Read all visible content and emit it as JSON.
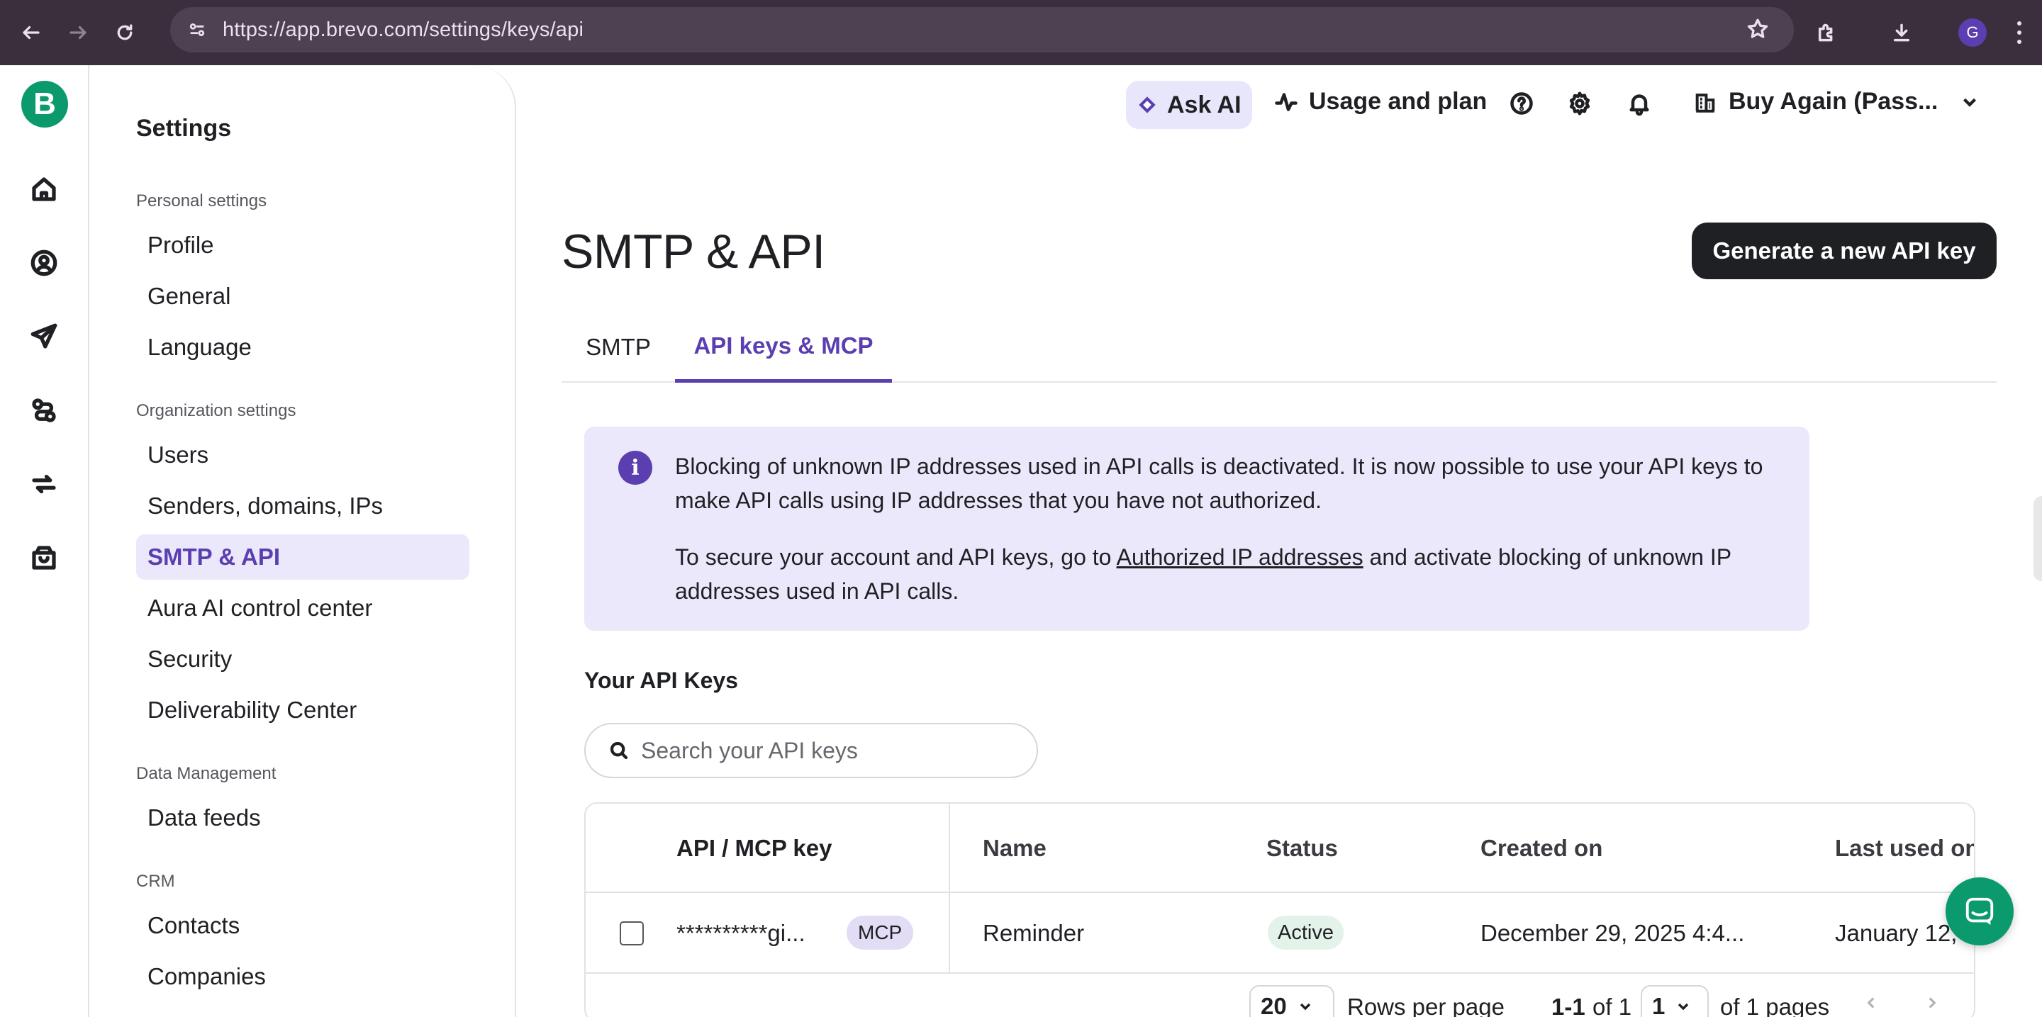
{
  "browser": {
    "url": "https://app.brevo.com/settings/keys/api",
    "profile_initial": "G"
  },
  "rail": {
    "logo_letter": "B",
    "icons": [
      "home-icon",
      "contacts-icon",
      "campaigns-icon",
      "automations-icon",
      "conversations-icon",
      "commerce-icon"
    ]
  },
  "sidebar": {
    "title": "Settings",
    "sections": [
      {
        "label": "Personal settings",
        "items": [
          "Profile",
          "General",
          "Language"
        ]
      },
      {
        "label": "Organization settings",
        "items": [
          "Users",
          "Senders, domains, IPs",
          "SMTP & API",
          "Aura AI control center",
          "Security",
          "Deliverability Center"
        ]
      },
      {
        "label": "Data Management",
        "items": [
          "Data feeds"
        ]
      },
      {
        "label": "CRM",
        "items": [
          "Contacts",
          "Companies"
        ]
      }
    ],
    "active_item": "SMTP & API"
  },
  "header": {
    "ask_ai": "Ask AI",
    "usage": "Usage and plan",
    "account": "Buy Again (Pass..."
  },
  "page": {
    "title": "SMTP & API",
    "primary_button": "Generate a new API key",
    "tabs": [
      "SMTP",
      "API keys & MCP"
    ],
    "active_tab": "API keys & MCP"
  },
  "banner": {
    "line1": "Blocking of unknown IP addresses used in API calls is deactivated. It is now possible to use your API keys to make API calls using IP addresses that you have not authorized.",
    "line2_before": "To secure your account and API keys, go to ",
    "line2_link": "Authorized IP addresses",
    "line2_after": " and activate blocking of unknown IP addresses used in API calls."
  },
  "keys": {
    "title": "Your API Keys",
    "search_placeholder": "Search your API keys",
    "columns": [
      "API / MCP key",
      "Name",
      "Status",
      "Created on",
      "Last used on"
    ],
    "rows": [
      {
        "key": "**********gi...",
        "badge": "MCP",
        "name": "Reminder",
        "status": "Active",
        "created": "December 29, 2025 4:4...",
        "last_used": "January 12,"
      }
    ],
    "pager": {
      "rows_per_page_value": "20",
      "rows_per_page_label": "Rows per page",
      "range": "1-1",
      "of_total": "of 1",
      "page_value": "1",
      "of_pages": "of 1 pages"
    }
  },
  "colors": {
    "accent": "#5b3fb0",
    "accent_bg": "#ebe8fb",
    "brand_green": "#0b996e",
    "primary_button": "#1f2024"
  }
}
